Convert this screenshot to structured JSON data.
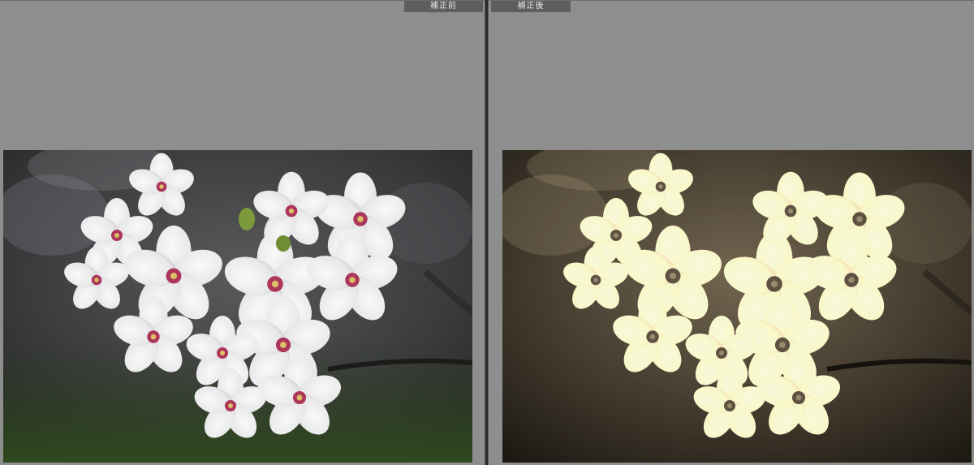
{
  "before": {
    "label": "補正前"
  },
  "after": {
    "label": "補正後"
  },
  "icons": {
    "before_photo": "cherry-blossom-photo",
    "after_photo": "cherry-blossom-photo-sepia"
  },
  "colors": {
    "panel_bg": "#8e8e8e",
    "label_bg": "#5e5e5e",
    "label_text": "#e6e6e6",
    "divider": "#2b2b2b"
  }
}
